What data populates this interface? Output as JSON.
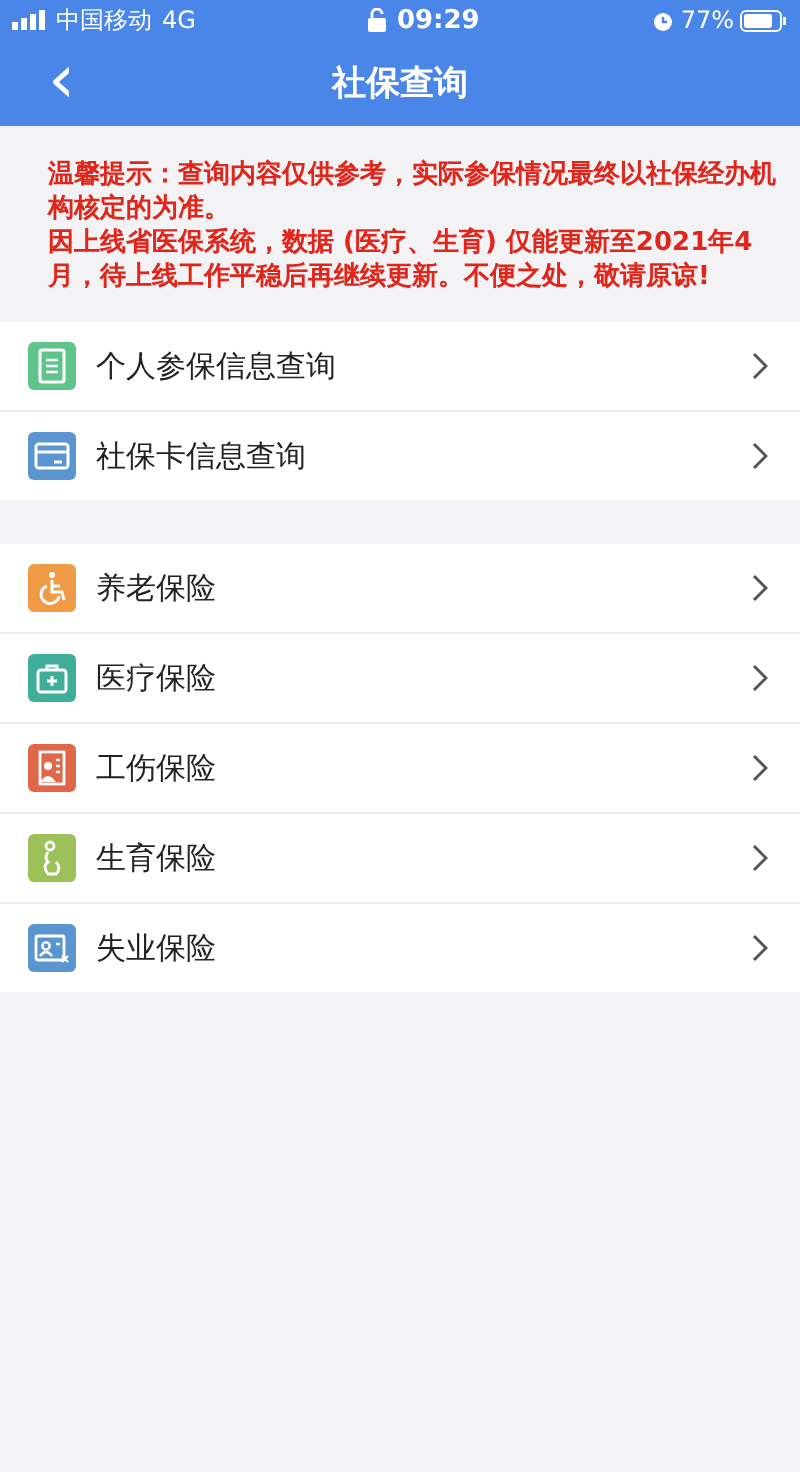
{
  "status_bar": {
    "carrier": "中国移动",
    "network": "4G",
    "time": "09:29",
    "battery": "77%"
  },
  "header": {
    "back": "‹",
    "title": "社保查询"
  },
  "notice": [
    "温馨提示：查询内容仅供参考，实际参保情况最终以社保经办机构核定的为准。",
    "因上线省医保系统，数据 (医疗、生育) 仅能更新至2021年4月，待上线工作平稳后再继续更新。不便之处，敬请原谅!"
  ],
  "groups": [
    {
      "items": [
        {
          "label": "个人参保信息查询",
          "kind": "document",
          "color": "#5fc48a"
        },
        {
          "label": "社保卡信息查询",
          "kind": "card",
          "color": "#5b95cf"
        }
      ]
    },
    {
      "items": [
        {
          "label": "养老保险",
          "kind": "wheelchair",
          "color": "#ef9a45"
        },
        {
          "label": "医疗保险",
          "kind": "medkit",
          "color": "#3fae98"
        },
        {
          "label": "工伤保险",
          "kind": "worker",
          "color": "#e0674a"
        },
        {
          "label": "生育保险",
          "kind": "pregnant",
          "color": "#9cc158"
        },
        {
          "label": "失业保险",
          "kind": "idcard",
          "color": "#5b95cf"
        }
      ]
    }
  ]
}
